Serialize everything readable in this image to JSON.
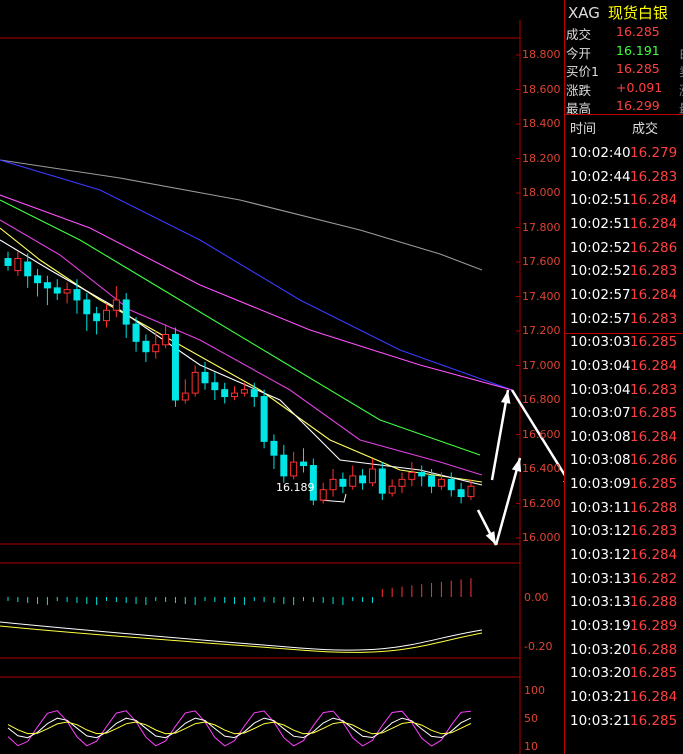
{
  "header": {
    "symbol": "XAG",
    "name": "现货白银"
  },
  "quote": [
    {
      "label": "成交",
      "value": "16.285",
      "color": "#ff4040"
    },
    {
      "label": "今开",
      "value": "16.191",
      "color": "#40ff40"
    },
    {
      "label": "买价1",
      "value": "16.285",
      "color": "#ff4040"
    },
    {
      "label": "涨跌",
      "value": "+0.091",
      "color": "#ff4040"
    },
    {
      "label": "最高",
      "value": "16.299",
      "color": "#ff4040"
    }
  ],
  "quote_edge": [
    "白",
    "卖",
    "涨",
    "最"
  ],
  "ticks_header": {
    "time": "时间",
    "price": "成交"
  },
  "ticks": [
    {
      "time": "10:02:40",
      "price": "16.279"
    },
    {
      "time": "10:02:44",
      "price": "16.283"
    },
    {
      "time": "10:02:51",
      "price": "16.284"
    },
    {
      "time": "10:02:51",
      "price": "16.284"
    },
    {
      "time": "10:02:52",
      "price": "16.286"
    },
    {
      "time": "10:02:52",
      "price": "16.283"
    },
    {
      "time": "10:02:57",
      "price": "16.284"
    },
    {
      "time": "10:02:57",
      "price": "16.283"
    },
    {
      "time": "10:03:03",
      "price": "16.285"
    },
    {
      "time": "10:03:04",
      "price": "16.284"
    },
    {
      "time": "10:03:04",
      "price": "16.283"
    },
    {
      "time": "10:03:07",
      "price": "16.285"
    },
    {
      "time": "10:03:08",
      "price": "16.284"
    },
    {
      "time": "10:03:08",
      "price": "16.286"
    },
    {
      "time": "10:03:09",
      "price": "16.285"
    },
    {
      "time": "10:03:11",
      "price": "16.288"
    },
    {
      "time": "10:03:12",
      "price": "16.283"
    },
    {
      "time": "10:03:12",
      "price": "16.284"
    },
    {
      "time": "10:03:13",
      "price": "16.282"
    },
    {
      "time": "10:03:13",
      "price": "16.288"
    },
    {
      "time": "10:03:19",
      "price": "16.289"
    },
    {
      "time": "10:03:20",
      "price": "16.288"
    },
    {
      "time": "10:03:20",
      "price": "16.285"
    },
    {
      "time": "10:03:21",
      "price": "16.284"
    },
    {
      "time": "10:03:21",
      "price": "16.285"
    }
  ],
  "price_axis": [
    "18.800",
    "18.600",
    "18.400",
    "18.200",
    "18.000",
    "17.800",
    "17.600",
    "17.400",
    "17.200",
    "17.000",
    "16.800",
    "16.600",
    "16.400",
    "16.200",
    "16.000"
  ],
  "macd_axis": [
    "0.00",
    "-0.20"
  ],
  "kdj_axis": [
    "100",
    "50",
    "10"
  ],
  "annotation": "16.189",
  "colors": {
    "up": "#ff3030",
    "down": "#00e5e5",
    "border": "#b00000",
    "axis_text": "#dd3b2a"
  },
  "chart_data": {
    "type": "candlestick",
    "title": "XAG 现货白银",
    "ylim": [
      16.0,
      18.9
    ],
    "candles": [
      [
        17.62,
        17.58,
        17.66,
        17.55
      ],
      [
        17.55,
        17.62,
        17.66,
        17.52
      ],
      [
        17.6,
        17.52,
        17.65,
        17.45
      ],
      [
        17.52,
        17.48,
        17.56,
        17.4
      ],
      [
        17.48,
        17.45,
        17.52,
        17.35
      ],
      [
        17.45,
        17.42,
        17.5,
        17.38
      ],
      [
        17.42,
        17.44,
        17.48,
        17.36
      ],
      [
        17.44,
        17.38,
        17.5,
        17.3
      ],
      [
        17.38,
        17.3,
        17.42,
        17.2
      ],
      [
        17.3,
        17.26,
        17.34,
        17.18
      ],
      [
        17.26,
        17.32,
        17.36,
        17.22
      ],
      [
        17.32,
        17.38,
        17.46,
        17.28
      ],
      [
        17.38,
        17.24,
        17.42,
        17.16
      ],
      [
        17.24,
        17.14,
        17.28,
        17.08
      ],
      [
        17.14,
        17.08,
        17.18,
        17.02
      ],
      [
        17.08,
        17.12,
        17.2,
        17.04
      ],
      [
        17.12,
        17.18,
        17.24,
        17.1
      ],
      [
        17.18,
        16.8,
        17.22,
        16.76
      ],
      [
        16.8,
        16.84,
        16.92,
        16.78
      ],
      [
        16.84,
        16.96,
        17.0,
        16.82
      ],
      [
        16.96,
        16.9,
        17.02,
        16.86
      ],
      [
        16.9,
        16.86,
        16.96,
        16.8
      ],
      [
        16.86,
        16.82,
        16.9,
        16.78
      ],
      [
        16.82,
        16.84,
        16.88,
        16.8
      ],
      [
        16.84,
        16.86,
        16.9,
        16.82
      ],
      [
        16.86,
        16.82,
        16.9,
        16.76
      ],
      [
        16.82,
        16.56,
        16.86,
        16.52
      ],
      [
        16.56,
        16.48,
        16.6,
        16.4
      ],
      [
        16.48,
        16.36,
        16.54,
        16.32
      ],
      [
        16.36,
        16.44,
        16.5,
        16.34
      ],
      [
        16.44,
        16.42,
        16.52,
        16.38
      ],
      [
        16.42,
        16.22,
        16.46,
        16.19
      ],
      [
        16.22,
        16.28,
        16.32,
        16.2
      ],
      [
        16.28,
        16.34,
        16.4,
        16.24
      ],
      [
        16.34,
        16.3,
        16.38,
        16.26
      ],
      [
        16.3,
        16.36,
        16.42,
        16.28
      ],
      [
        16.36,
        16.32,
        16.4,
        16.28
      ],
      [
        16.32,
        16.4,
        16.46,
        16.3
      ],
      [
        16.4,
        16.26,
        16.44,
        16.22
      ],
      [
        16.26,
        16.3,
        16.34,
        16.24
      ],
      [
        16.3,
        16.34,
        16.38,
        16.26
      ],
      [
        16.34,
        16.38,
        16.44,
        16.3
      ],
      [
        16.38,
        16.36,
        16.42,
        16.3
      ],
      [
        16.36,
        16.3,
        16.4,
        16.26
      ],
      [
        16.3,
        16.34,
        16.38,
        16.28
      ],
      [
        16.34,
        16.28,
        16.38,
        16.24
      ],
      [
        16.28,
        16.24,
        16.32,
        16.2
      ],
      [
        16.24,
        16.3,
        16.34,
        16.22
      ]
    ]
  }
}
